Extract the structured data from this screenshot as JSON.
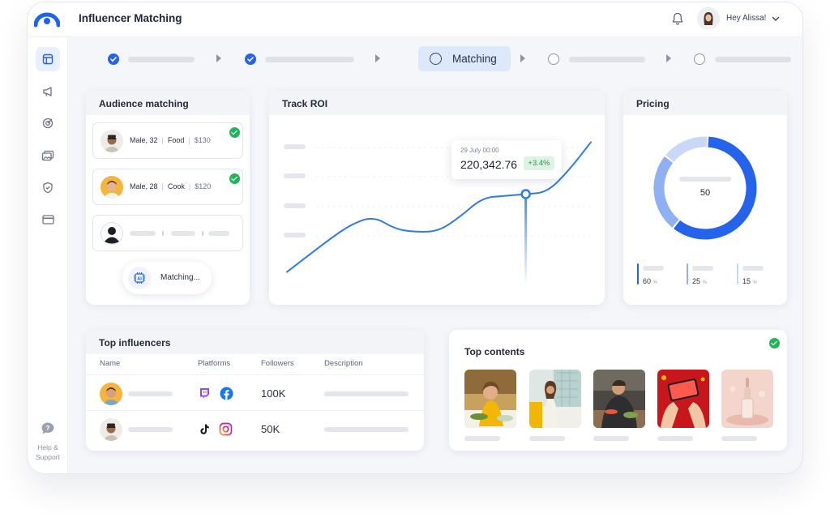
{
  "app": {
    "title": "Influencer Matching",
    "greeting": "Hey Alissa!"
  },
  "sidebar": {
    "help_line1": "Help &",
    "help_line2": "Support"
  },
  "stepper": {
    "active_label": "Matching"
  },
  "audience": {
    "title": "Audience  matching",
    "rows": [
      {
        "person": "Male, 32",
        "interest": "Food",
        "price": "$130"
      },
      {
        "person": "Male, 28",
        "interest": "Cook",
        "price": "$120"
      }
    ],
    "matching_label": "Matching..."
  },
  "roi": {
    "title": "Track ROI",
    "tooltip_date": "29 July 00:00",
    "tooltip_value": "220,342.76",
    "tooltip_change": "+3.4%"
  },
  "pricing": {
    "title": "Pricing",
    "center_value": "50",
    "legend": [
      {
        "value": "60",
        "unit": "%",
        "color": "#2563eb"
      },
      {
        "value": "25",
        "unit": "%",
        "color": "#8fb0f3"
      },
      {
        "value": "15",
        "unit": "%",
        "color": "#c9d8f8"
      }
    ]
  },
  "top_influencers": {
    "title": "Top influencers",
    "columns": [
      "Name",
      "Platforms",
      "Followers",
      "Description"
    ],
    "rows": [
      {
        "followers": "100K",
        "platforms": [
          "twitch-icon",
          "facebook-icon"
        ]
      },
      {
        "followers": "50K",
        "platforms": [
          "tiktok-icon",
          "instagram-icon"
        ]
      }
    ]
  },
  "top_contents": {
    "title": "Top contents"
  },
  "colors": {
    "accent": "#2563eb",
    "success": "#22b45a",
    "chart_line": "#2f7be5"
  },
  "chart_data": {
    "type": "line",
    "title": "Track ROI",
    "xlabel": "",
    "ylabel": "",
    "series": [
      {
        "values": [
          10,
          28,
          46,
          62,
          70,
          56,
          53,
          54,
          70,
          90,
          92,
          94,
          96,
          120,
          150
        ]
      }
    ],
    "highlight": {
      "label": "29 July 00:00",
      "value": "220,342.76",
      "change": "+3.4%",
      "index": 11
    },
    "ylim": [
      0,
      160
    ],
    "grid": false,
    "legend": "none"
  }
}
